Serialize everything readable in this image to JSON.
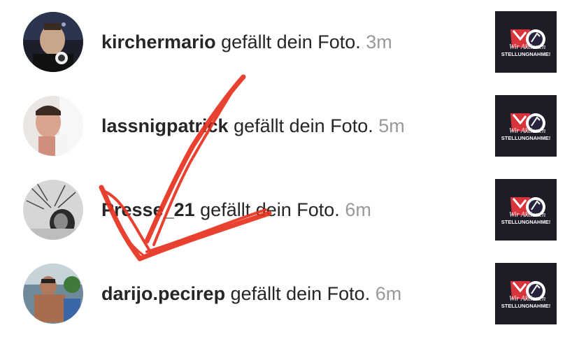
{
  "notifications": [
    {
      "username": "kirchermario",
      "action": "gefällt dein Foto.",
      "time": "3m"
    },
    {
      "username": "lassnigpatrick",
      "action": "gefällt dein Foto.",
      "time": "5m"
    },
    {
      "username": "Presse_21",
      "action": "gefällt dein Foto.",
      "time": "6m"
    },
    {
      "username": "darijo.pecirep",
      "action": "gefällt dein Foto.",
      "time": "6m"
    }
  ],
  "thumbnail": {
    "logo_text": "Wir Aktionen",
    "caption": "STELLUNGNAHME!"
  },
  "annotation": {
    "color": "#e8311f",
    "icon": "hand-drawn-arrow"
  }
}
